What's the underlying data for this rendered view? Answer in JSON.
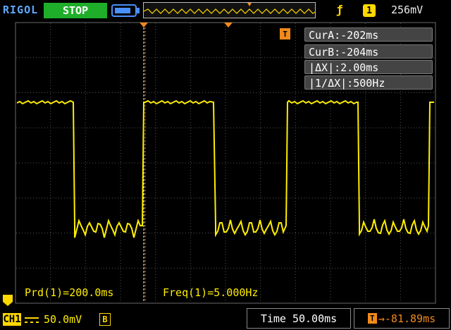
{
  "header": {
    "brand": "RIGOL",
    "run_state": "STOP",
    "trigger_source": "1",
    "trigger_level": "256mV"
  },
  "cursors": {
    "cur_a": "CurA:-202ms",
    "cur_b": "CurB:-204ms",
    "delta_x": "|ΔX|:2.00ms",
    "inv_delta_x": "|1/ΔX|:500Hz"
  },
  "trigger_marker": "T",
  "measurements": {
    "period": "Prd(1)=200.0ms",
    "frequency": "Freq(1)=5.000Hz"
  },
  "channel1": {
    "label": "CH1",
    "scale": "50.0mV",
    "bandwidth_limit": "B"
  },
  "horizontal": {
    "timebase": "Time 50.00ms",
    "trigger_offset": "→-81.89ms",
    "trigger_offset_icon": "T"
  },
  "colors": {
    "trace": "#ffee00",
    "grid": "#5a5a5a",
    "stop_badge": "#1fae2a",
    "brand": "#5fa8ff",
    "trigger": "#f08a1c"
  },
  "icons": {
    "battery": "battery-icon",
    "trigger_edge": "rising-edge-icon",
    "coupling": "dc-coupling-icon"
  }
}
